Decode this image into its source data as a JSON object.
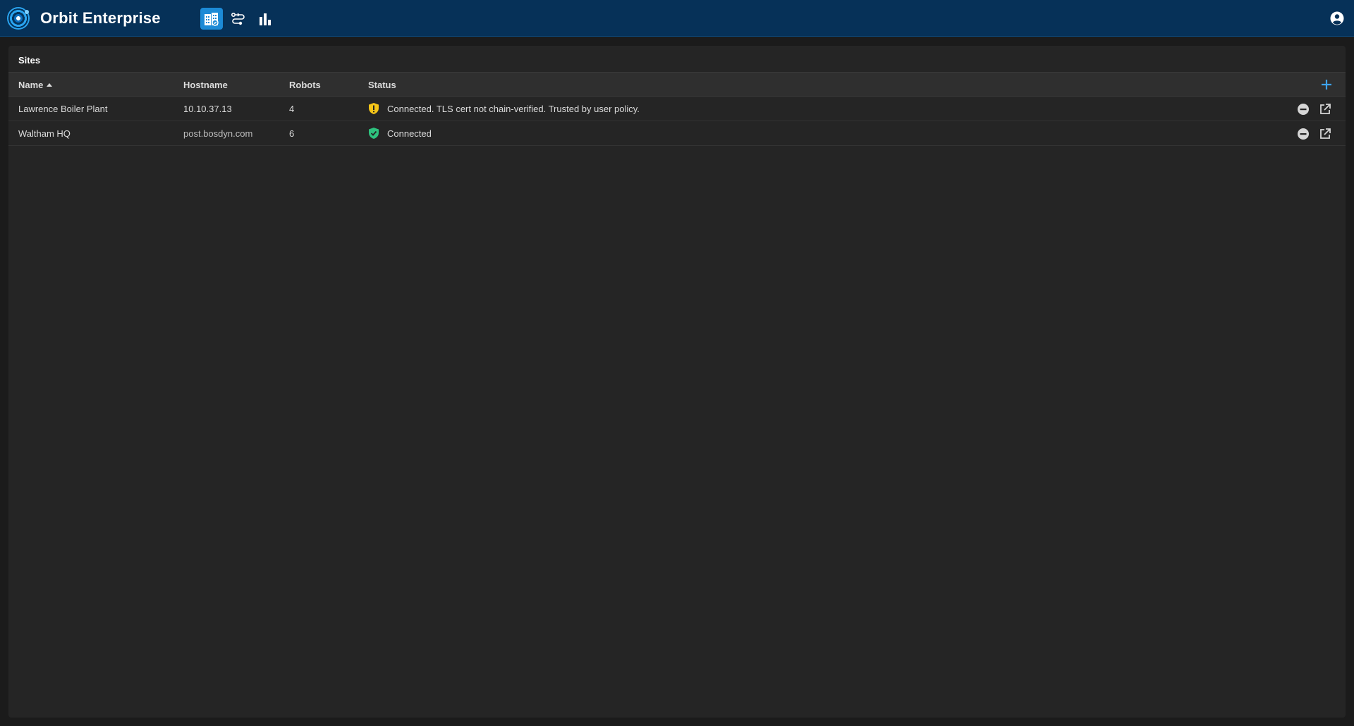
{
  "app": {
    "title": "Orbit Enterprise",
    "accent": "#1c8ad6",
    "topbar_color": "#063158"
  },
  "nav": [
    {
      "icon": "sites-icon",
      "active": true
    },
    {
      "icon": "routes-icon",
      "active": false
    },
    {
      "icon": "bar-chart-icon",
      "active": false
    }
  ],
  "panel": {
    "title": "Sites",
    "columns": {
      "name": "Name",
      "hostname": "Hostname",
      "robots": "Robots",
      "status": "Status"
    },
    "sort": {
      "column": "Name",
      "direction": "ascending"
    },
    "rows": [
      {
        "name": "Lawrence Boiler Plant",
        "hostname": "10.10.37.13",
        "robots": "4",
        "status": "Connected. TLS cert not chain-verified. Trusted by user policy.",
        "status_icon": "shield-warning-icon",
        "status_color": "#f5c518"
      },
      {
        "name": "Waltham HQ",
        "hostname": "post.bosdyn.com",
        "robots": "6",
        "status": "Connected",
        "status_icon": "shield-check-icon",
        "status_color": "#2ec27e"
      }
    ]
  }
}
